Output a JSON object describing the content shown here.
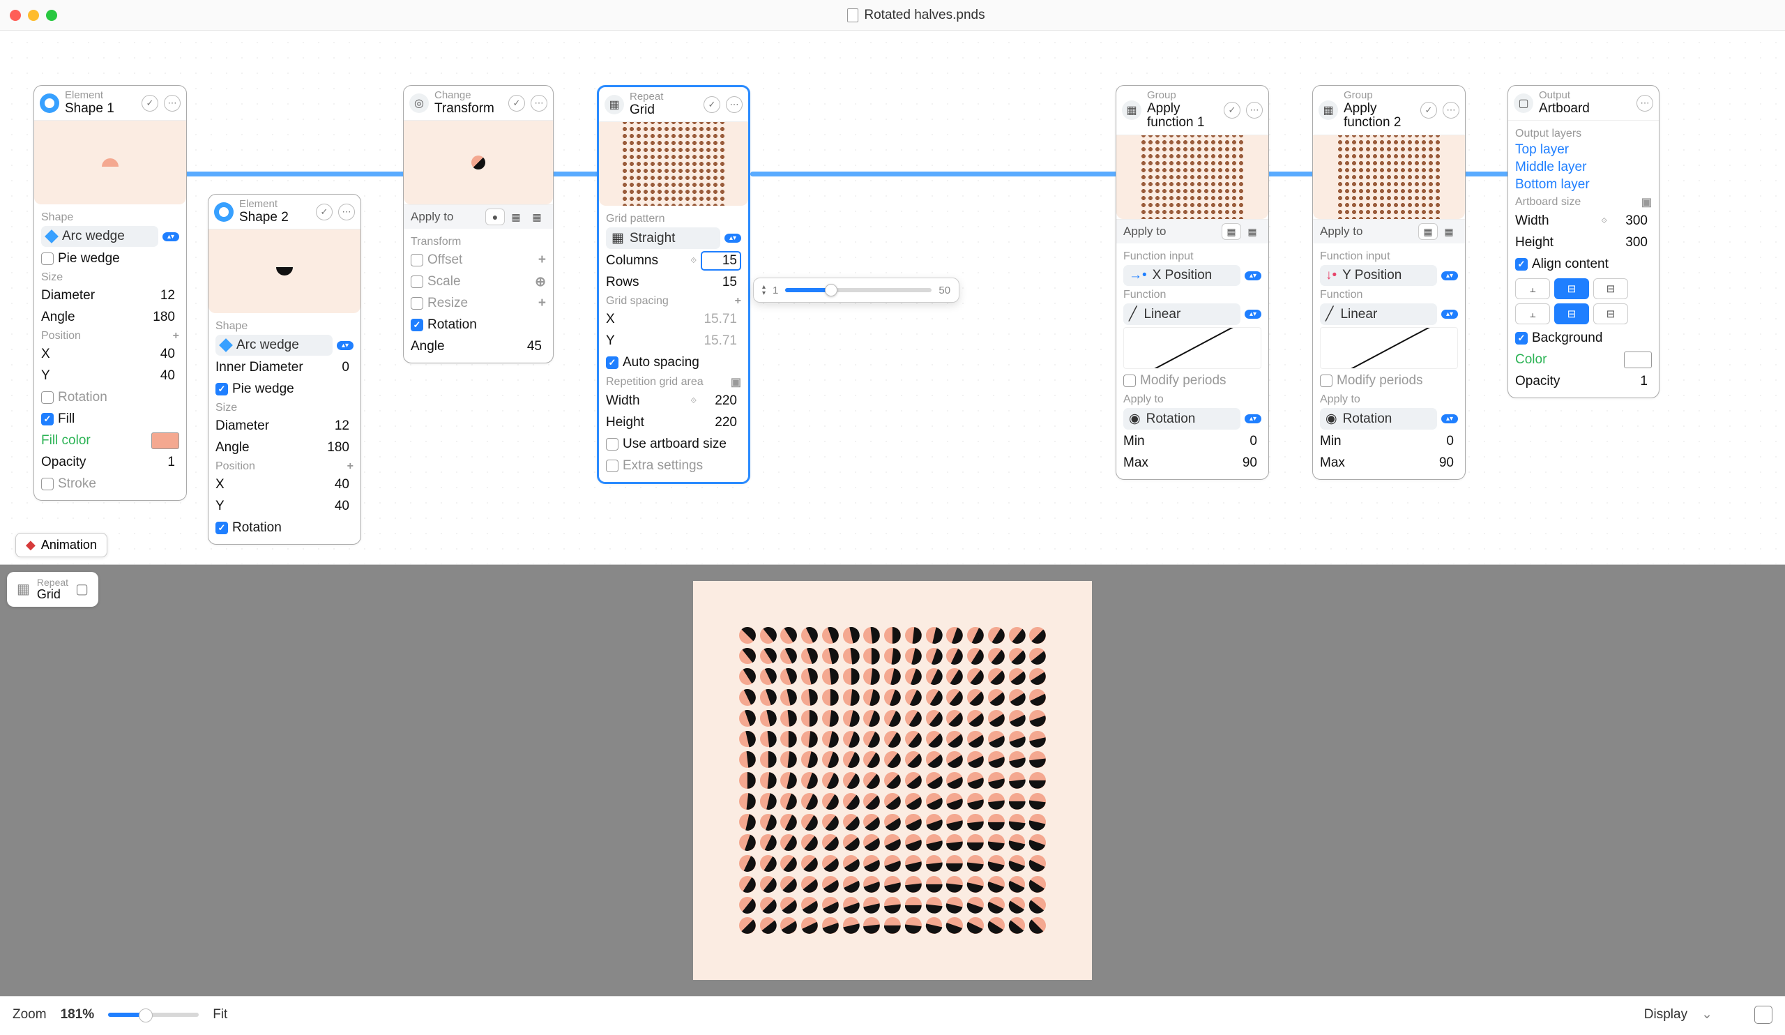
{
  "titlebar": {
    "filename": "Rotated halves.pnds"
  },
  "nodes": {
    "shape1": {
      "type_label": "Element",
      "title": "Shape 1",
      "sections": {
        "shape": "Shape",
        "shape_kind": "Arc wedge",
        "pie_wedge": "Pie wedge",
        "size": "Size",
        "diameter_label": "Diameter",
        "diameter_val": "12",
        "angle_label": "Angle",
        "angle_val": "180",
        "position": "Position",
        "x_label": "X",
        "x_val": "40",
        "y_label": "Y",
        "y_val": "40",
        "rotation_label": "Rotation",
        "fill_label": "Fill",
        "fillcolor_label": "Fill color",
        "opacity_label": "Opacity",
        "opacity_val": "1",
        "stroke_label": "Stroke"
      }
    },
    "shape2": {
      "type_label": "Element",
      "title": "Shape 2",
      "sections": {
        "shape": "Shape",
        "shape_kind": "Arc wedge",
        "inner_diameter_label": "Inner Diameter",
        "inner_diameter_val": "0",
        "pie_wedge": "Pie wedge",
        "size": "Size",
        "diameter_label": "Diameter",
        "diameter_val": "12",
        "angle_label": "Angle",
        "angle_val": "180",
        "position": "Position",
        "x_label": "X",
        "x_val": "40",
        "y_label": "Y",
        "y_val": "40",
        "rotation_label": "Rotation"
      }
    },
    "transform": {
      "type_label": "Change",
      "title": "Transform",
      "apply_to": "Apply to",
      "transform": "Transform",
      "offset": "Offset",
      "scale": "Scale",
      "resize": "Resize",
      "rotation": "Rotation",
      "angle_label": "Angle",
      "angle_val": "45"
    },
    "grid": {
      "type_label": "Repeat",
      "title": "Grid",
      "pattern": "Grid pattern",
      "straight": "Straight",
      "columns_label": "Columns",
      "columns_val": "15",
      "rows_label": "Rows",
      "rows_val": "15",
      "spacing": "Grid spacing",
      "x_label": "X",
      "x_val": "15.71",
      "y_label": "Y",
      "y_val": "15.71",
      "auto": "Auto spacing",
      "rep_area": "Repetition grid area",
      "width_label": "Width",
      "width_val": "220",
      "height_label": "Height",
      "height_val": "220",
      "artboard_size": "Use artboard size",
      "extra": "Extra settings"
    },
    "func1": {
      "type_label": "Group",
      "title": "Apply function 1",
      "apply_to": "Apply to",
      "func_input": "Function input",
      "input_kind": "X Position",
      "function": "Function",
      "func_kind": "Linear",
      "mod_periods": "Modify periods",
      "apply_to2": "Apply to",
      "target": "Rotation",
      "min_label": "Min",
      "min_val": "0",
      "max_label": "Max",
      "max_val": "90"
    },
    "func2": {
      "type_label": "Group",
      "title": "Apply function 2",
      "apply_to": "Apply to",
      "func_input": "Function input",
      "input_kind": "Y Position",
      "function": "Function",
      "func_kind": "Linear",
      "mod_periods": "Modify periods",
      "apply_to2": "Apply to",
      "target": "Rotation",
      "min_label": "Min",
      "min_val": "0",
      "max_label": "Max",
      "max_val": "90"
    },
    "artboard": {
      "type_label": "Output",
      "title": "Artboard",
      "output_layers": "Output layers",
      "top": "Top layer",
      "middle": "Middle layer",
      "bottom": "Bottom layer",
      "size": "Artboard size",
      "width_label": "Width",
      "width_val": "300",
      "height_label": "Height",
      "height_val": "300",
      "align": "Align content",
      "background": "Background",
      "color_label": "Color",
      "opacity_label": "Opacity",
      "opacity_val": "1"
    }
  },
  "popover": {
    "value": "15",
    "min": "1",
    "max": "50"
  },
  "render_chip": {
    "sub": "Repeat",
    "title": "Grid"
  },
  "animation_label": "Animation",
  "statusbar": {
    "zoom_label": "Zoom",
    "zoom_val": "181%",
    "fit_label": "Fit",
    "display_label": "Display"
  }
}
